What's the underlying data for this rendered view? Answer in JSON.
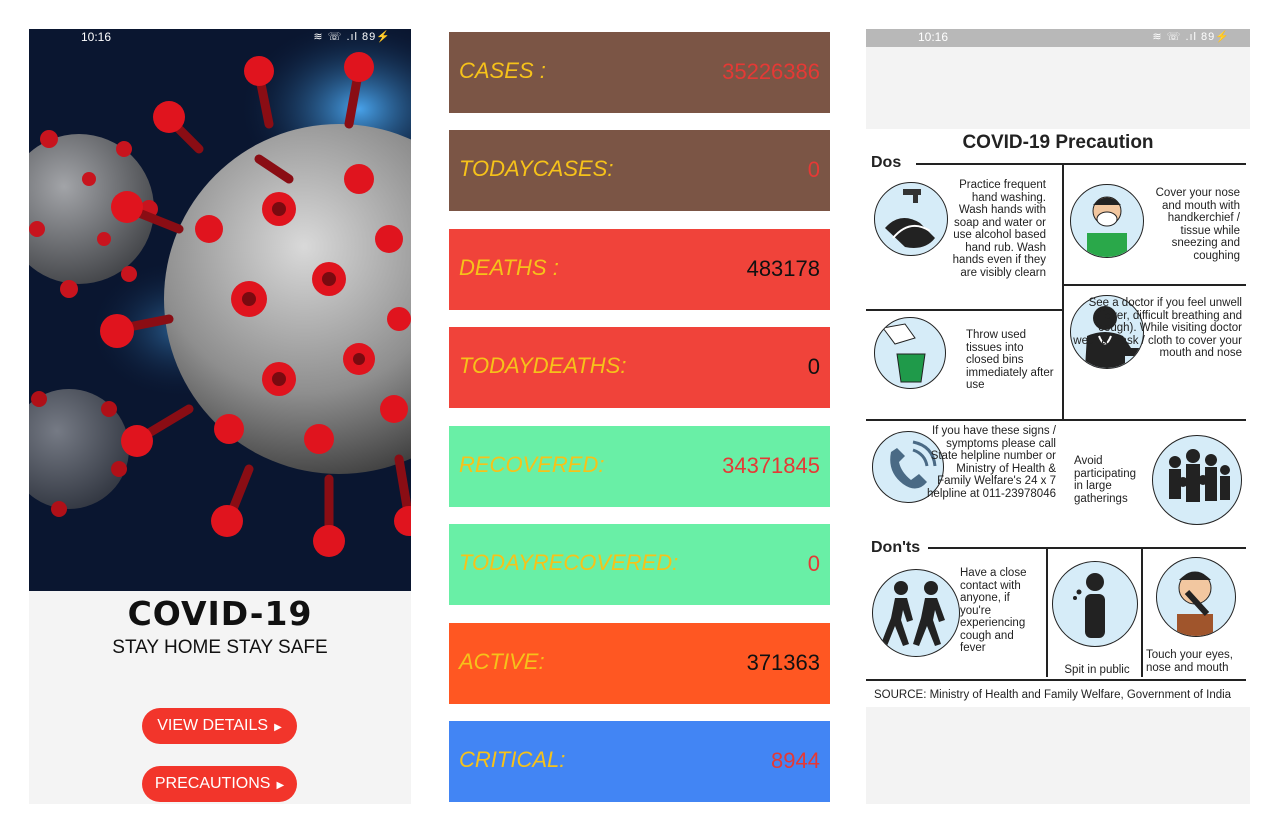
{
  "screen1": {
    "status_time": "10:16",
    "status_icons": "≋ ☏ .ıl 89⚡",
    "title": "COVID-19",
    "tagline": "STAY HOME STAY SAFE",
    "view_details_label": "VIEW DETAILS",
    "precautions_label": "PRECAUTIONS"
  },
  "screen2": {
    "rows": [
      {
        "label": "CASES :",
        "value": "35226386",
        "bg": "#7b5545",
        "value_color": "#e53935"
      },
      {
        "label": "TODAYCASES:",
        "value": "0",
        "bg": "#7b5545",
        "value_color": "#e53935"
      },
      {
        "label": "DEATHS :",
        "value": "483178",
        "bg": "#f0433a",
        "value_color": "#111111"
      },
      {
        "label": "TODAYDEATHS:",
        "value": "0",
        "bg": "#f0433a",
        "value_color": "#111111"
      },
      {
        "label": "RECOVERED:",
        "value": "34371845",
        "bg": "#69efa6",
        "value_color": "#e53935"
      },
      {
        "label": "TODAYRECOVERED:",
        "value": "0",
        "bg": "#69efa6",
        "value_color": "#e53935"
      },
      {
        "label": "ACTIVE:",
        "value": "371363",
        "bg": "#ff5722",
        "value_color": "#111111"
      },
      {
        "label": "CRITICAL:",
        "value": "8944",
        "bg": "#4285f4",
        "value_color": "#e53935"
      }
    ]
  },
  "screen3": {
    "status_time": "10:16",
    "status_icons": "≋ ☏ .ıl 89⚡",
    "poster": {
      "title": "COVID-19 Precaution",
      "dos_heading": "Dos",
      "donts_heading": "Don'ts",
      "dos": [
        "Practice frequent hand washing. Wash hands with soap and water or use alcohol based hand rub. Wash hands even if they are visibly clearn",
        "Cover your nose and mouth with handkerchief / tissue while sneezing and coughing",
        "Throw used tissues into closed bins immediately after use",
        "See a doctor if you feel unwell (fever, difficult breathing and cough). While visiting doctor wear a mask / cloth to cover your mouth and nose",
        "If you have these signs / symptoms please call State helpline number or Ministry of Health & Family Welfare's 24 x 7 helpline at 011-23978046",
        "Avoid participating in large gatherings"
      ],
      "donts": [
        "Have a close contact with anyone, if you're experiencing cough and fever",
        "Spit in public",
        "Touch your eyes, nose and mouth"
      ],
      "source": "SOURCE: Ministry of Health and Family Welfare, Government of India"
    }
  }
}
